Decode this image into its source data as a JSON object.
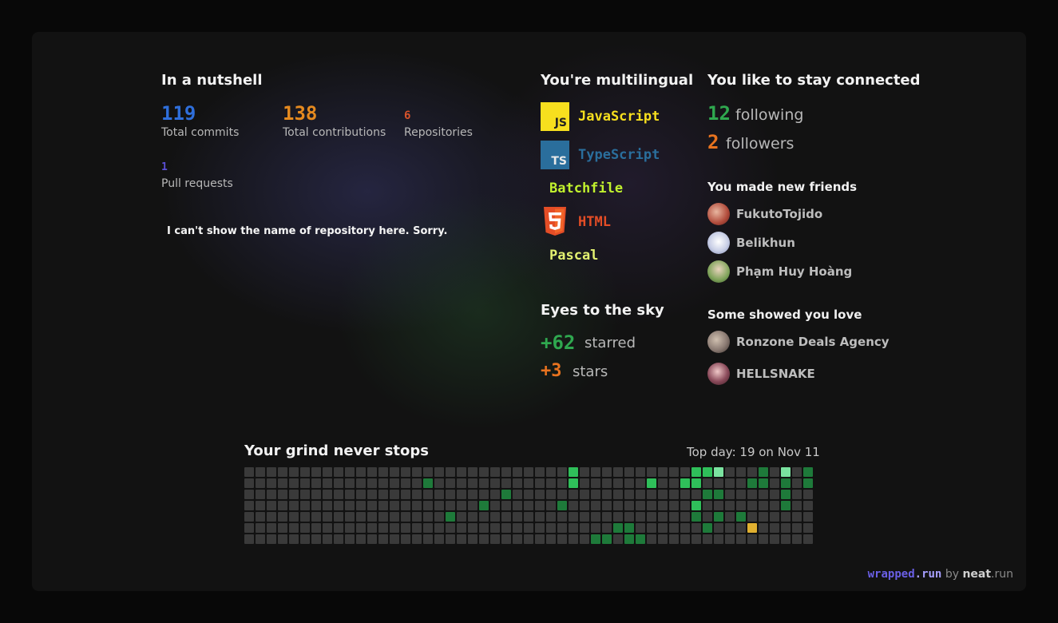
{
  "nutshell": {
    "title": "In a nutshell",
    "stats": [
      {
        "value": "119",
        "label": "Total commits",
        "color": "#2f6fdb"
      },
      {
        "value": "138",
        "label": "Total contributions",
        "color": "#e58a1f"
      },
      {
        "value": "6",
        "label": "Repositories",
        "color": "#d9532b"
      },
      {
        "value": "1",
        "label": "Pull requests",
        "color": "#5b4fd6"
      }
    ],
    "note": "I can't show the name of repository here. Sorry."
  },
  "languages": {
    "title": "You're multilingual",
    "items": [
      {
        "name": "JavaScript",
        "badge": "JS",
        "icon": "javascript-icon",
        "color": "#f7df1e",
        "text_color": "#f7df1e"
      },
      {
        "name": "TypeScript",
        "badge": "TS",
        "icon": "typescript-icon",
        "color": "#2f74c0",
        "text_color": "#2a6e9c"
      },
      {
        "name": "Batchfile",
        "badge": "",
        "icon": "",
        "color": "",
        "text_color": "#c1f12e"
      },
      {
        "name": "HTML",
        "badge": "5",
        "icon": "html5-icon",
        "color": "#e44d26",
        "text_color": "#e44d26"
      },
      {
        "name": "Pascal",
        "badge": "",
        "icon": "",
        "color": "",
        "text_color": "#e3f171"
      }
    ]
  },
  "stars": {
    "title": "Eyes to the sky",
    "starred_value": "+62",
    "starred_label": "starred",
    "stars_value": "+3",
    "stars_label": "stars"
  },
  "connected": {
    "title": "You like to stay connected",
    "following_value": "12",
    "following_label": "following",
    "followers_value": "2",
    "followers_label": "followers"
  },
  "friends": {
    "title": "You made new friends",
    "items": [
      {
        "name": "FukutoTojido",
        "avatar_color": "#b04a3a"
      },
      {
        "name": "Belikhun",
        "avatar_color": "#c9cfe6"
      },
      {
        "name": "Phạm Huy Hoàng",
        "avatar_color": "#7fa35a"
      }
    ]
  },
  "love": {
    "title": "Some showed you love",
    "items": [
      {
        "name": "Ronzone Deals Agency",
        "avatar_color": "#8a7a72"
      },
      {
        "name": "HELLSNAKE",
        "avatar_color": "#8a4a5a"
      }
    ]
  },
  "grind": {
    "title": "Your grind never stops",
    "top_day": "Top day: 19 on Nov 11",
    "weeks": 51,
    "days": 7,
    "colors": {
      "empty": "#3a3a3a",
      "level1": "#1e7a3a",
      "level2": "#2fbf5a",
      "level3": "#7be3a0",
      "top": "#e0b030"
    },
    "active_cells": [
      [
        28,
        1,
        1
      ],
      [
        30,
        4,
        1
      ],
      [
        33,
        3,
        1
      ],
      [
        35,
        2,
        1
      ],
      [
        40,
        3,
        1
      ],
      [
        41,
        1,
        2
      ],
      [
        43,
        6,
        1
      ],
      [
        41,
        0,
        2
      ],
      [
        44,
        6,
        1
      ],
      [
        45,
        5,
        1
      ],
      [
        46,
        5,
        1
      ],
      [
        46,
        6,
        1
      ],
      [
        47,
        6,
        1
      ],
      [
        51,
        1,
        2
      ],
      [
        48,
        1,
        2
      ],
      [
        52,
        1,
        2
      ],
      [
        52,
        3,
        2
      ],
      [
        53,
        0,
        2
      ],
      [
        54,
        0,
        3
      ],
      [
        52,
        0,
        2
      ],
      [
        53,
        2,
        1
      ],
      [
        54,
        4,
        1
      ],
      [
        52,
        4,
        1
      ],
      [
        53,
        5,
        1
      ],
      [
        54,
        2,
        1
      ],
      [
        56,
        4,
        1
      ],
      [
        58,
        0,
        1
      ],
      [
        58,
        1,
        1
      ],
      [
        60,
        0,
        3
      ],
      [
        60,
        1,
        1
      ],
      [
        60,
        2,
        1
      ],
      [
        60,
        3,
        1
      ],
      [
        62,
        0,
        1
      ],
      [
        62,
        1,
        1
      ],
      [
        57,
        1,
        1
      ],
      [
        57,
        5,
        4
      ]
    ]
  },
  "footer": {
    "brand": "wrapped",
    "brand_suffix": ".run",
    "by": "by",
    "maker": "neat",
    "maker_suffix": ".run"
  }
}
